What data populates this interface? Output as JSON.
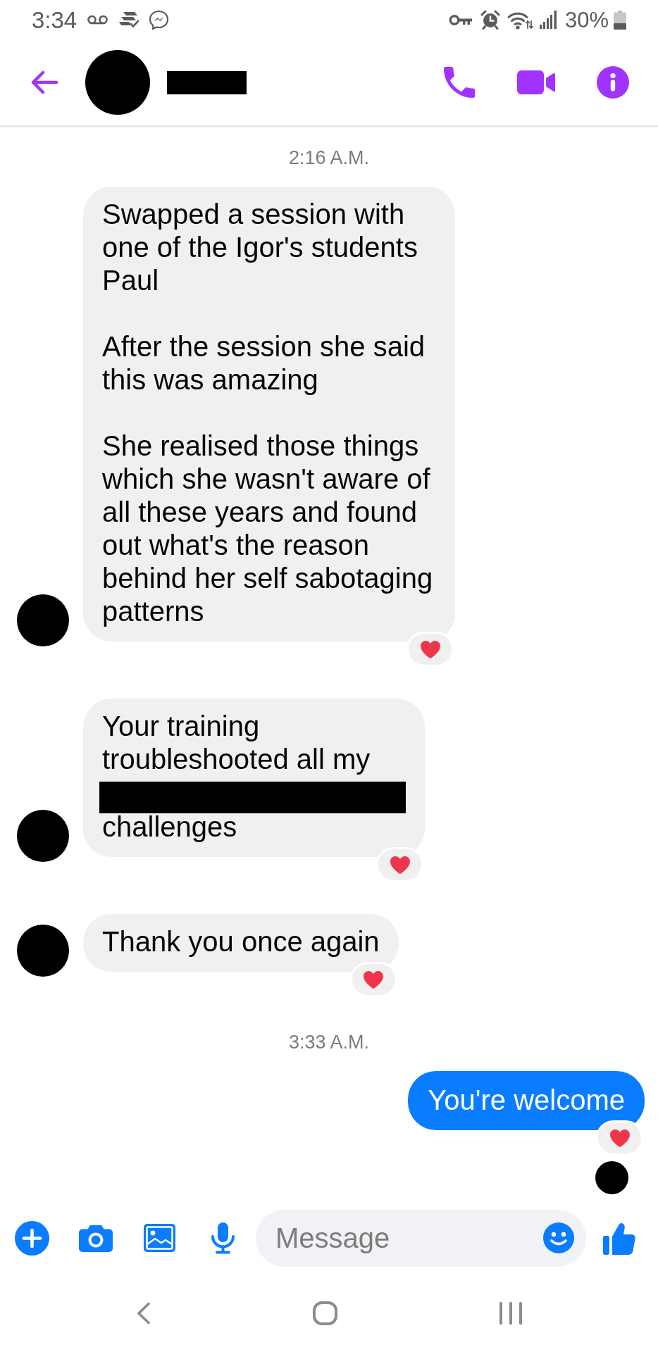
{
  "status_bar": {
    "time": "3:34",
    "battery_percent": "30%"
  },
  "header": {
    "avatar": true,
    "name_redacted": true
  },
  "conversation": [
    {
      "kind": "timestamp",
      "text": "2:16 A.M."
    },
    {
      "kind": "incoming",
      "avatar": true,
      "hearted": true,
      "parts": [
        {
          "kind": "text",
          "text": "Swapped a session with one of the Igor's students Paul"
        },
        {
          "kind": "text",
          "text": "After the session she said this was amazing"
        },
        {
          "kind": "text",
          "text": "She realised those things which she wasn't aware of all these years and found out what's the reason behind her self sabotaging patterns"
        }
      ]
    },
    {
      "kind": "incoming",
      "avatar": true,
      "hearted": true,
      "parts": [
        {
          "kind": "text",
          "text": "Your training troubleshooted all my"
        },
        {
          "kind": "redacted"
        },
        {
          "kind": "text",
          "text": "challenges"
        }
      ]
    },
    {
      "kind": "incoming",
      "avatar": true,
      "hearted": true,
      "parts": [
        {
          "kind": "text",
          "text": "Thank you once again"
        }
      ]
    },
    {
      "kind": "timestamp",
      "text": "3:33 A.M."
    },
    {
      "kind": "outgoing",
      "seen": true,
      "hearted": true,
      "parts": [
        {
          "kind": "text",
          "text": "You're welcome"
        }
      ]
    }
  ],
  "composer": {
    "placeholder": "Message"
  }
}
